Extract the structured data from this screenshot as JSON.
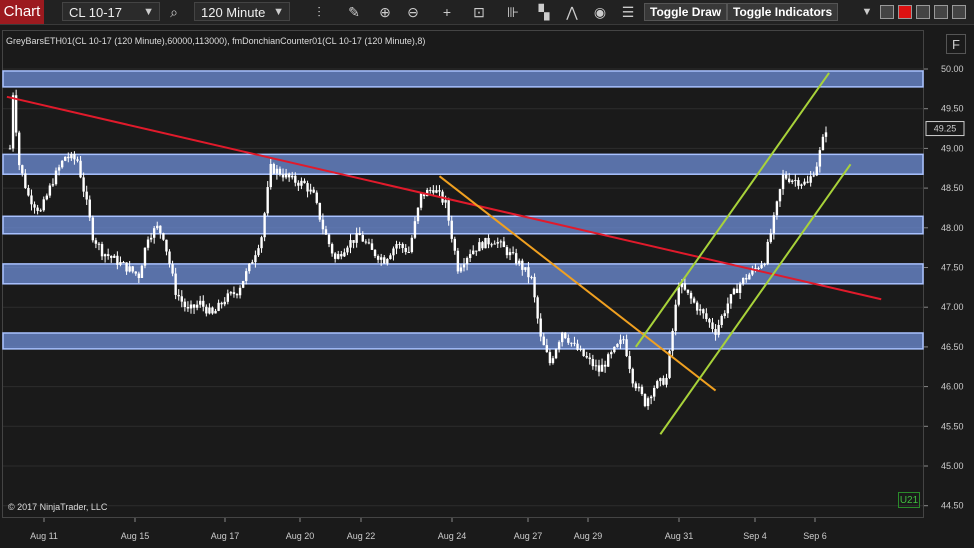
{
  "toolbar": {
    "chart_tab": "Chart",
    "instrument": "CL 10-17",
    "interval": "120 Minute",
    "toggle_draw": "Toggle Draw",
    "toggle_indicators": "Toggle Indicators"
  },
  "header_text": "GreyBarsETH01(CL 10-17 (120 Minute),60000,113000), fmDonchianCounter01(CL 10-17 (120 Minute),8)",
  "copyright": "© 2017 NinjaTrader, LLC",
  "f_label": "F",
  "u_label": "U21",
  "colors": {
    "zone_fill": "#6f8fd8",
    "zone_border": "#a9c2ff",
    "red_line": "#e11a2b",
    "orange_line": "#f0a020",
    "green_line": "#a8d23a",
    "candle": "#ffffff",
    "chart_tab": "#9c1a1f"
  },
  "chart_data": {
    "type": "candlestick",
    "y_ticks": [
      "50.00",
      "49.50",
      "49.00",
      "48.50",
      "48.00",
      "47.50",
      "47.00",
      "46.50",
      "46.00",
      "45.50",
      "45.00",
      "44.50"
    ],
    "ylim": [
      44.5,
      50.0
    ],
    "x_ticks": [
      "Aug 11",
      "Aug 15",
      "Aug 17",
      "Aug 20",
      "Aug 22",
      "Aug 24",
      "Aug 27",
      "Aug 29",
      "Aug 31",
      "Sep 4",
      "Sep 6"
    ],
    "last_price": "49.25",
    "zones": [
      {
        "low": 49.8,
        "high": 49.95
      },
      {
        "low": 48.7,
        "high": 48.9
      },
      {
        "low": 47.95,
        "high": 48.12
      },
      {
        "low": 47.32,
        "high": 47.52
      },
      {
        "low": 46.5,
        "high": 46.65
      }
    ],
    "close_path": [
      [
        0,
        49.0
      ],
      [
        1,
        49.7
      ],
      [
        3,
        48.8
      ],
      [
        6,
        48.4
      ],
      [
        10,
        48.2
      ],
      [
        14,
        48.6
      ],
      [
        18,
        48.9
      ],
      [
        22,
        48.85
      ],
      [
        25,
        48.3
      ],
      [
        27,
        47.9
      ],
      [
        30,
        47.7
      ],
      [
        34,
        47.6
      ],
      [
        38,
        47.5
      ],
      [
        42,
        47.4
      ],
      [
        45,
        47.9
      ],
      [
        48,
        48.0
      ],
      [
        50,
        47.9
      ],
      [
        54,
        47.2
      ],
      [
        58,
        46.95
      ],
      [
        62,
        47.05
      ],
      [
        66,
        46.9
      ],
      [
        70,
        47.1
      ],
      [
        74,
        47.2
      ],
      [
        78,
        47.5
      ],
      [
        82,
        47.9
      ],
      [
        85,
        48.75
      ],
      [
        88,
        48.7
      ],
      [
        92,
        48.6
      ],
      [
        96,
        48.55
      ],
      [
        99,
        48.4
      ],
      [
        102,
        48.0
      ],
      [
        106,
        47.6
      ],
      [
        110,
        47.8
      ],
      [
        114,
        47.9
      ],
      [
        118,
        47.7
      ],
      [
        122,
        47.6
      ],
      [
        126,
        47.8
      ],
      [
        130,
        47.7
      ],
      [
        134,
        48.4
      ],
      [
        138,
        48.5
      ],
      [
        142,
        48.3
      ],
      [
        146,
        47.5
      ],
      [
        150,
        47.7
      ],
      [
        154,
        47.8
      ],
      [
        158,
        47.85
      ],
      [
        162,
        47.7
      ],
      [
        166,
        47.55
      ],
      [
        170,
        47.35
      ],
      [
        173,
        46.6
      ],
      [
        176,
        46.3
      ],
      [
        180,
        46.7
      ],
      [
        184,
        46.5
      ],
      [
        188,
        46.35
      ],
      [
        192,
        46.2
      ],
      [
        196,
        46.4
      ],
      [
        200,
        46.6
      ],
      [
        203,
        46.1
      ],
      [
        207,
        45.8
      ],
      [
        210,
        46.0
      ],
      [
        214,
        46.1
      ],
      [
        218,
        47.3
      ],
      [
        222,
        47.1
      ],
      [
        226,
        46.9
      ],
      [
        230,
        46.7
      ],
      [
        234,
        47.05
      ],
      [
        238,
        47.3
      ],
      [
        242,
        47.45
      ],
      [
        246,
        47.6
      ],
      [
        249,
        48.1
      ],
      [
        252,
        48.65
      ],
      [
        256,
        48.6
      ],
      [
        260,
        48.55
      ],
      [
        263,
        48.8
      ],
      [
        266,
        49.25
      ]
    ],
    "lines": [
      {
        "name": "",
        "color": "red",
        "points": [
          [
            -1,
            49.65
          ],
          [
            284,
            47.1
          ]
        ]
      },
      {
        "name": "",
        "color": "orange",
        "points": [
          [
            140,
            48.65
          ],
          [
            230,
            45.95
          ]
        ]
      },
      {
        "name": "",
        "color": "green",
        "points": [
          [
            204,
            46.5
          ],
          [
            267,
            49.95
          ]
        ]
      },
      {
        "name": "",
        "color": "green",
        "points": [
          [
            212,
            45.4
          ],
          [
            274,
            48.8
          ]
        ]
      }
    ],
    "x_count": 286
  }
}
